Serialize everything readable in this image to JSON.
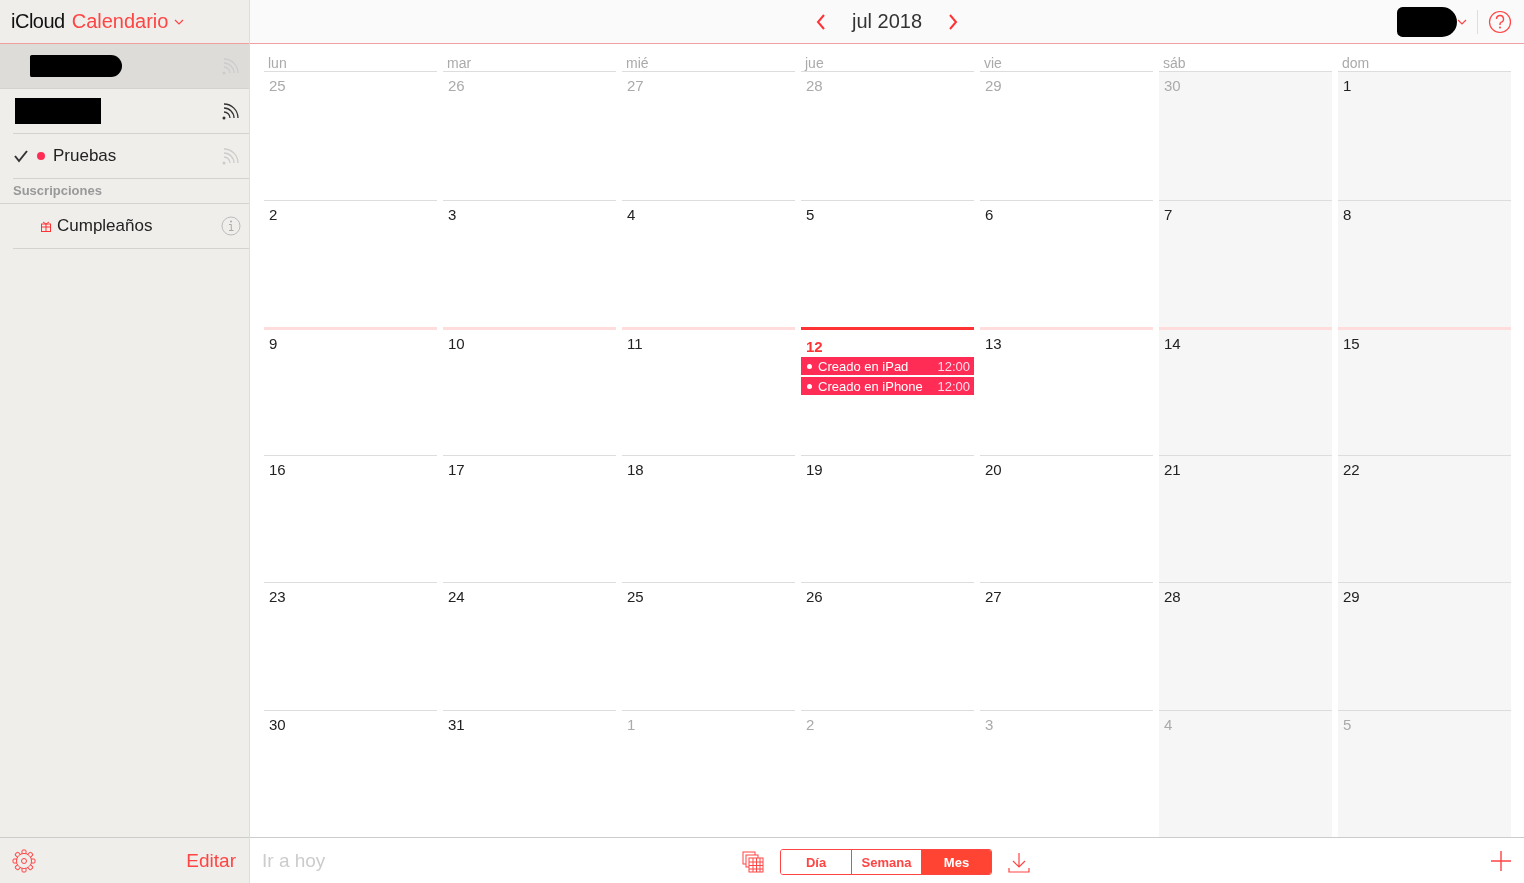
{
  "app": {
    "brand": "iCloud",
    "title": "Calendario"
  },
  "sidebar": {
    "calendars": [
      {
        "kind": "redacted",
        "selected": true,
        "published": false
      },
      {
        "kind": "redacted",
        "selected": false,
        "published": true
      },
      {
        "kind": "calendar",
        "label": "Pruebas",
        "checked": true,
        "color": "#ff2d55",
        "selected": false,
        "published": false
      }
    ],
    "section_title": "Suscripciones",
    "subscriptions": [
      {
        "label": "Cumpleaños",
        "selected": false
      }
    ],
    "edit_label": "Editar"
  },
  "toolbar": {
    "month": "jul 2018"
  },
  "weekdays": [
    "lun",
    "mar",
    "mié",
    "jue",
    "vie",
    "sáb",
    "dom"
  ],
  "weeks": [
    [
      {
        "day": "25",
        "in_month": false
      },
      {
        "day": "26",
        "in_month": false
      },
      {
        "day": "27",
        "in_month": false
      },
      {
        "day": "28",
        "in_month": false
      },
      {
        "day": "29",
        "in_month": false
      },
      {
        "day": "30",
        "in_month": false
      },
      {
        "day": "1",
        "in_month": true
      }
    ],
    [
      {
        "day": "2",
        "in_month": true
      },
      {
        "day": "3",
        "in_month": true
      },
      {
        "day": "4",
        "in_month": true
      },
      {
        "day": "5",
        "in_month": true
      },
      {
        "day": "6",
        "in_month": true
      },
      {
        "day": "7",
        "in_month": true
      },
      {
        "day": "8",
        "in_month": true
      }
    ],
    [
      {
        "day": "9",
        "in_month": true
      },
      {
        "day": "10",
        "in_month": true
      },
      {
        "day": "11",
        "in_month": true
      },
      {
        "day": "12",
        "in_month": true,
        "today": true,
        "events": [
          {
            "title": "Creado en iPad",
            "time": "12:00"
          },
          {
            "title": "Creado en iPhone",
            "time": "12:00"
          }
        ]
      },
      {
        "day": "13",
        "in_month": true
      },
      {
        "day": "14",
        "in_month": true
      },
      {
        "day": "15",
        "in_month": true
      }
    ],
    [
      {
        "day": "16",
        "in_month": true
      },
      {
        "day": "17",
        "in_month": true
      },
      {
        "day": "18",
        "in_month": true
      },
      {
        "day": "19",
        "in_month": true
      },
      {
        "day": "20",
        "in_month": true
      },
      {
        "day": "21",
        "in_month": true
      },
      {
        "day": "22",
        "in_month": true
      }
    ],
    [
      {
        "day": "23",
        "in_month": true
      },
      {
        "day": "24",
        "in_month": true
      },
      {
        "day": "25",
        "in_month": true
      },
      {
        "day": "26",
        "in_month": true
      },
      {
        "day": "27",
        "in_month": true
      },
      {
        "day": "28",
        "in_month": true
      },
      {
        "day": "29",
        "in_month": true
      }
    ],
    [
      {
        "day": "30",
        "in_month": true
      },
      {
        "day": "31",
        "in_month": true
      },
      {
        "day": "1",
        "in_month": false
      },
      {
        "day": "2",
        "in_month": false
      },
      {
        "day": "3",
        "in_month": false
      },
      {
        "day": "4",
        "in_month": false
      },
      {
        "day": "5",
        "in_month": false
      }
    ]
  ],
  "footer": {
    "today_label": "Ir a hoy",
    "views": [
      {
        "label": "Día",
        "selected": false
      },
      {
        "label": "Semana",
        "selected": false
      },
      {
        "label": "Mes",
        "selected": true
      }
    ]
  }
}
